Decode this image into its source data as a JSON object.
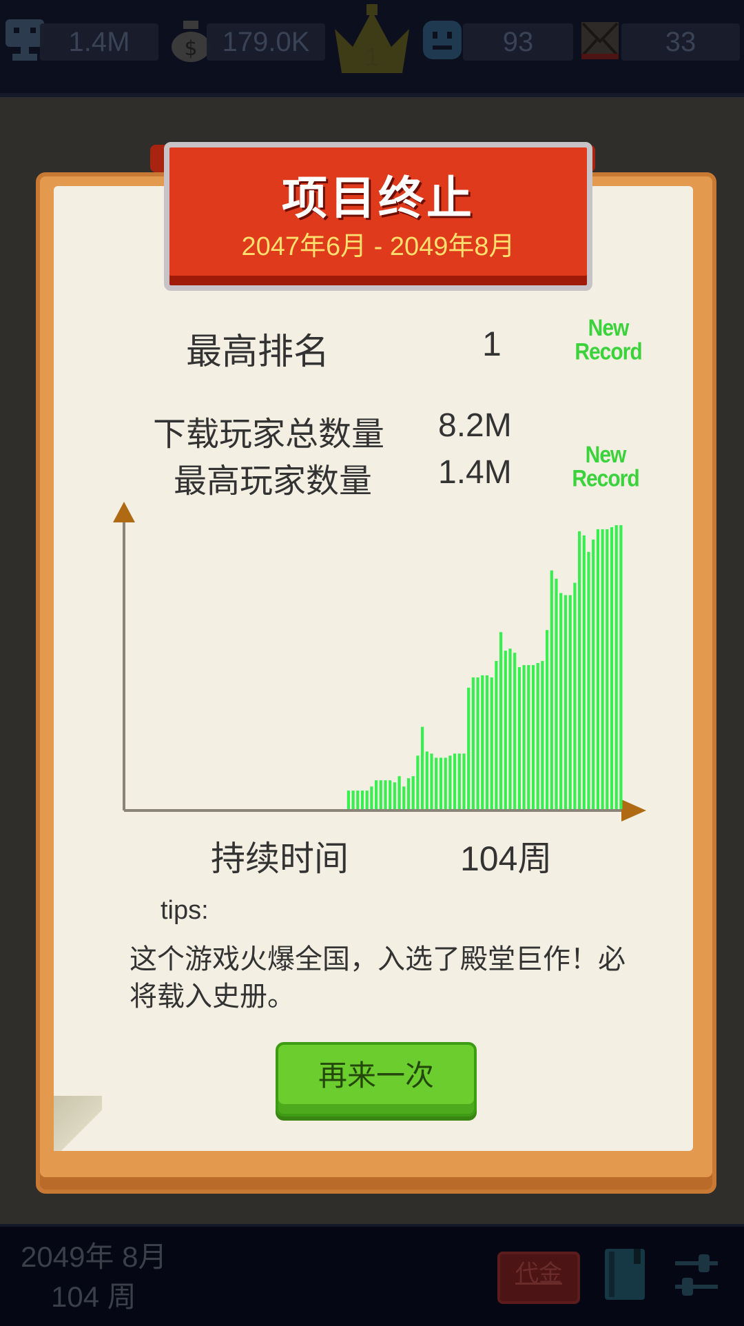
{
  "topbar": {
    "players_value": "1.4M",
    "money_value": "179.0K",
    "rank_value": "1",
    "fans_value": "93",
    "mail_value": "33"
  },
  "dialog": {
    "title": "项目终止",
    "period": "2047年6月 - 2049年8月",
    "best_rank_label": "最高排名",
    "best_rank_value": "1",
    "new_record_line1": "New",
    "new_record_line2": "Record",
    "total_downloads_label": "下载玩家总数量",
    "total_downloads_value": "8.2M",
    "peak_players_label": "最高玩家数量",
    "peak_players_value": "1.4M",
    "duration_label": "持续时间",
    "duration_value": "104周",
    "tips_label": "tips:",
    "tips_text": "这个游戏火爆全国，入选了殿堂巨作！必将载入史册。",
    "retry_button": "再来一次"
  },
  "bottombar": {
    "date_line1": "2049年 8月",
    "date_line2": "104 周",
    "fund_button": "代金"
  },
  "colors": {
    "bar": "#39ee50",
    "ribbon": "#e03a1c",
    "card_border": "#e39a4f",
    "retry_button": "#6ccd2e"
  },
  "chart_data": {
    "type": "bar",
    "title": "",
    "xlabel": "",
    "ylabel": "",
    "unit": "weekly players (relative, peak = 1.4M)",
    "ylim": [
      0,
      1.4
    ],
    "values": [
      0,
      0,
      0,
      0,
      0,
      0,
      0,
      0,
      0,
      0,
      0,
      0,
      0,
      0,
      0,
      0,
      0,
      0,
      0,
      0,
      0,
      0,
      0,
      0,
      0,
      0,
      0,
      0,
      0,
      0,
      0,
      0,
      0,
      0,
      0,
      0,
      0,
      0,
      0,
      0,
      0,
      0,
      0,
      0,
      0,
      0,
      0,
      0,
      0.09,
      0.09,
      0.09,
      0.09,
      0.09,
      0.11,
      0.14,
      0.14,
      0.14,
      0.14,
      0.13,
      0.16,
      0.11,
      0.15,
      0.16,
      0.26,
      0.4,
      0.28,
      0.27,
      0.25,
      0.25,
      0.25,
      0.26,
      0.27,
      0.27,
      0.27,
      0.59,
      0.64,
      0.64,
      0.65,
      0.65,
      0.64,
      0.72,
      0.86,
      0.77,
      0.78,
      0.76,
      0.69,
      0.7,
      0.7,
      0.7,
      0.71,
      0.72,
      0.87,
      1.16,
      1.12,
      1.05,
      1.04,
      1.04,
      1.1,
      1.35,
      1.33,
      1.25,
      1.31,
      1.36,
      1.36,
      1.36,
      1.37,
      1.38,
      1.38
    ]
  }
}
